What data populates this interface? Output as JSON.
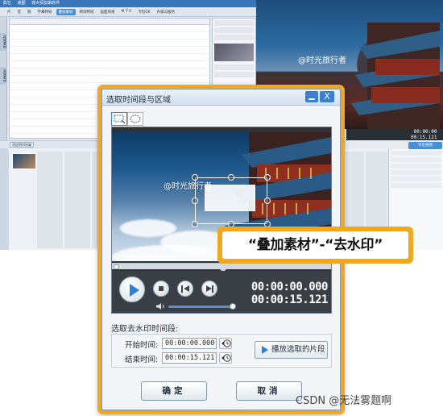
{
  "background_app": {
    "titlebar_items": [
      "影忆",
      "遮图",
      "镜大师剪辑软件"
    ],
    "menu_items": [
      "片",
      "音",
      "频",
      "字幕特效",
      "叠加素材",
      "转场特效",
      "画面风格",
      "M T V",
      "卡拉OK",
      "升级与服务"
    ],
    "active_menu_index": 4,
    "side_tabs": [
      "视频素材",
      "音频素材"
    ],
    "watermark_text": "@时光旅行者",
    "time_current": "00:00:00",
    "time_total": "00:15.121",
    "export_button": "导出视频",
    "add_clip_button": "添加到时间轴"
  },
  "dialog": {
    "title": "选取时间段与区域",
    "close_glyph": "X",
    "tools": [
      "rect-select",
      "ellipse-select"
    ],
    "video": {
      "watermark_text": "@时光旅行者"
    },
    "player": {
      "time_current": "00:00:00.000",
      "time_total": "00:00:15.121"
    },
    "range_section_label": "选取去水印时间段:",
    "start_label": "开始时间:",
    "start_value": "00:00:00.000",
    "end_label": "结束时间:",
    "end_value": "00:00:15.121",
    "play_selection_button": "播放选取的片段",
    "ok_button": "确定",
    "cancel_button": "取消"
  },
  "callout": {
    "text": "“叠加素材”-“去水印”"
  },
  "attribution": "CSDN @无法雾题啊",
  "colors": {
    "highlight_frame": "#f0a821",
    "accent_blue": "#3a7fd5",
    "player_bg": "#3a3f46"
  }
}
